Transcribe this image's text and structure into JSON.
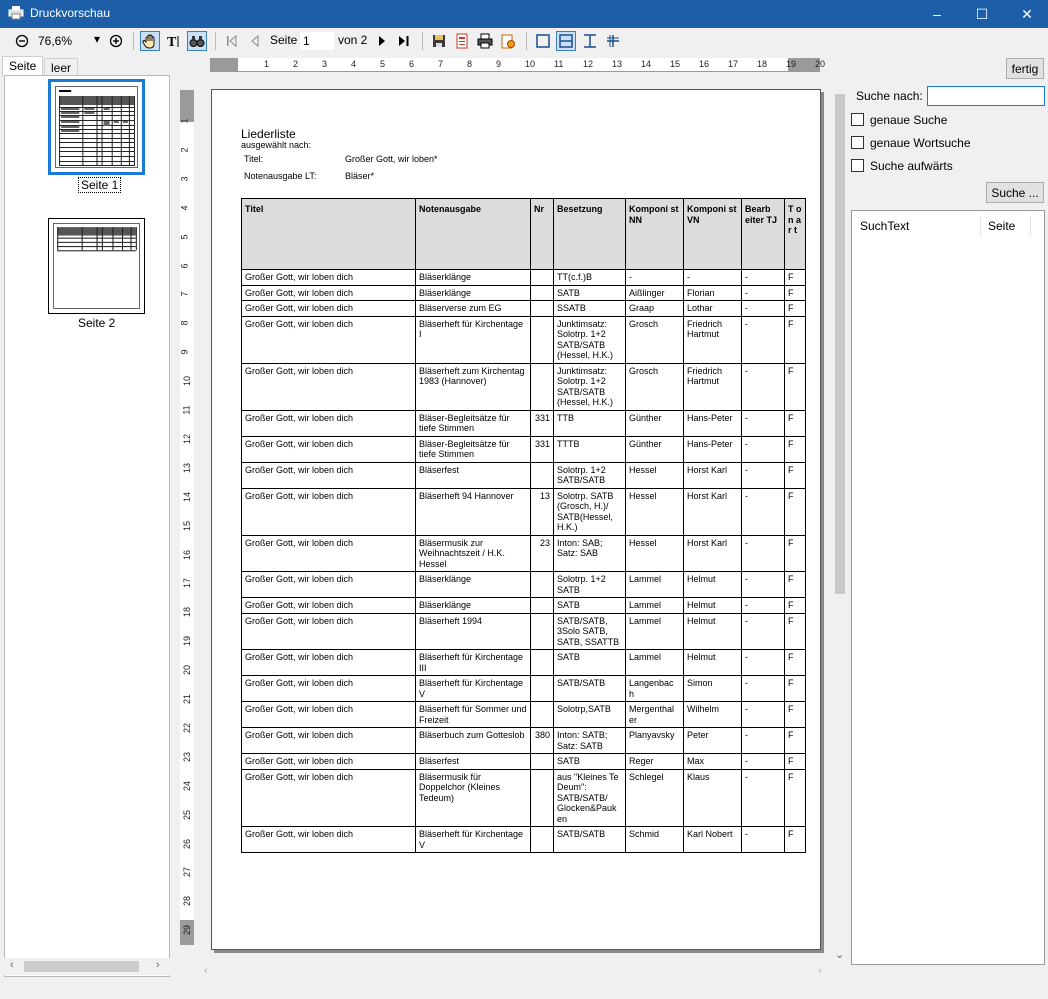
{
  "window": {
    "title": "Druckvorschau",
    "minimize": "–",
    "maximize": "☐",
    "close": "✕"
  },
  "toolbar": {
    "zoom": "76,6%",
    "zoom_dropdown": "▾",
    "page_label": "Seite",
    "page_value": "1",
    "of_label": "von 2"
  },
  "tabs": {
    "seite": "Seite",
    "leer": "leer"
  },
  "thumbnails": [
    {
      "label": "Seite 1",
      "selected": true
    },
    {
      "label": "Seite 2",
      "selected": false
    }
  ],
  "ruler": {
    "top": [
      "1",
      "2",
      "3",
      "4",
      "5",
      "6",
      "7",
      "8",
      "9",
      "10",
      "11",
      "12",
      "13",
      "14",
      "15",
      "16",
      "17",
      "18",
      "19",
      "20"
    ],
    "left": [
      "1",
      "2",
      "3",
      "4",
      "5",
      "6",
      "7",
      "8",
      "9",
      "10",
      "11",
      "12",
      "13",
      "14",
      "15",
      "16",
      "17",
      "18",
      "19",
      "20",
      "21",
      "22",
      "23",
      "24",
      "25",
      "26",
      "27",
      "28",
      "29"
    ]
  },
  "report": {
    "title": "Liederliste",
    "subtitle": "ausgewählt nach:",
    "filters": [
      {
        "key": "Titel:",
        "value": "Großer Gott, wir loben*"
      },
      {
        "key": "Notenausgabe LT:",
        "value": "Bläser*"
      }
    ],
    "columns": [
      "Titel",
      "Notenausgabe",
      "Nr",
      "Besetzung",
      "Komponi st NN",
      "Komponi st VN",
      "Bearb eiter TJ",
      "T o n a r t"
    ],
    "rows": [
      [
        "Großer Gott, wir loben dich",
        "Bläserklänge",
        "",
        "TT(c.f.)B",
        "-",
        "-",
        "-",
        "F"
      ],
      [
        "Großer Gott, wir loben dich",
        "Bläserklänge",
        "",
        "SATB",
        "Aißlinger",
        "Florian",
        "-",
        "F"
      ],
      [
        "Großer Gott, wir loben dich",
        "Bläserverse zum EG",
        "",
        "SSATB",
        "Graap",
        "Lothar",
        "-",
        "F"
      ],
      [
        "Großer Gott, wir loben dich",
        "Bläserheft für Kirchentage I",
        "",
        "Junktimsatz: Solotrp. 1+2 SATB/SATB (Hessel, H.K.)",
        "Grosch",
        "Friedrich Hartmut",
        "-",
        "F"
      ],
      [
        "Großer Gott, wir loben dich",
        "Bläserheft zum Kirchentag 1983 (Hannover)",
        "",
        "Junktimsatz: Solotrp. 1+2 SATB/SATB (Hessel, H.K.)",
        "Grosch",
        "Friedrich Hartmut",
        "-",
        "F"
      ],
      [
        "Großer Gott, wir loben dich",
        "Bläser-Begleitsätze für tiefe Stimmen",
        "331",
        "TTB",
        "Günther",
        "Hans-Peter",
        "-",
        "F"
      ],
      [
        "Großer Gott, wir loben dich",
        "Bläser-Begleitsätze für tiefe Stimmen",
        "331",
        "TTTB",
        "Günther",
        "Hans-Peter",
        "-",
        "F"
      ],
      [
        "Großer Gott, wir loben dich",
        "Bläserfest",
        "",
        "Solotrp. 1+2 SATB/SATB",
        "Hessel",
        "Horst Karl",
        "-",
        "F"
      ],
      [
        "Großer Gott, wir loben dich",
        "Bläserheft 94 Hannover",
        "13",
        "Solotrp. SATB (Grosch, H.)/ SATB(Hessel, H.K.)",
        "Hessel",
        "Horst Karl",
        "-",
        "F"
      ],
      [
        "Großer Gott, wir loben dich",
        "Bläsermusik zur Weihnachtszeit / H.K. Hessel",
        "23",
        "Inton: SAB; Satz: SAB",
        "Hessel",
        "Horst Karl",
        "-",
        "F"
      ],
      [
        "Großer Gott, wir loben dich",
        "Bläserklänge",
        "",
        "Solotrp. 1+2 SATB",
        "Lammel",
        "Helmut",
        "-",
        "F"
      ],
      [
        "Großer Gott, wir loben dich",
        "Bläserklänge",
        "",
        "SATB",
        "Lammel",
        "Helmut",
        "-",
        "F"
      ],
      [
        "Großer Gott, wir loben dich",
        "Bläserheft 1994",
        "",
        "SATB/SATB, 3Solo SATB, SATB, SSATTB",
        "Lammel",
        "Helmut",
        "-",
        "F"
      ],
      [
        "Großer Gott, wir loben dich",
        "Bläserheft für Kirchentage III",
        "",
        "SATB",
        "Lammel",
        "Helmut",
        "-",
        "F"
      ],
      [
        "Großer Gott, wir loben dich",
        "Bläserheft für Kirchentage V",
        "",
        "SATB/SATB",
        "Langenbac h",
        "Simon",
        "-",
        "F"
      ],
      [
        "Großer Gott, wir loben dich",
        "Bläserheft für Sommer und Freizeit",
        "",
        "Solotrp,SATB",
        "Mergenthal er",
        "Wilhelm",
        "-",
        "F"
      ],
      [
        "Großer Gott, wir loben dich",
        "Bläserbuch zum Gotteslob",
        "380",
        "Inton: SATB; Satz: SATB",
        "Planyavsky",
        "Peter",
        "-",
        "F"
      ],
      [
        "Großer Gott, wir loben dich",
        "Bläserfest",
        "",
        "SATB",
        "Reger",
        "Max",
        "-",
        "F"
      ],
      [
        "Großer Gott, wir loben dich",
        "Bläsermusik für Doppelchor (Kleines Tedeum)",
        "",
        "aus \"Kleines Te Deum\": SATB/SATB/ Glocken&Pauk en",
        "Schlegel",
        "Klaus",
        "-",
        "F"
      ],
      [
        "Großer Gott, wir loben dich",
        "Bläserheft für Kirchentage V",
        "",
        "SATB/SATB",
        "Schmid",
        "Karl Nobert",
        "-",
        "F"
      ]
    ]
  },
  "search": {
    "fertig": "fertig",
    "label": "Suche nach:",
    "value": "",
    "options": [
      "genaue Suche",
      "genaue Wortsuche",
      "Suche aufwärts"
    ],
    "button": "Suche ...",
    "col_text": "SuchText",
    "col_page": "Seite"
  }
}
